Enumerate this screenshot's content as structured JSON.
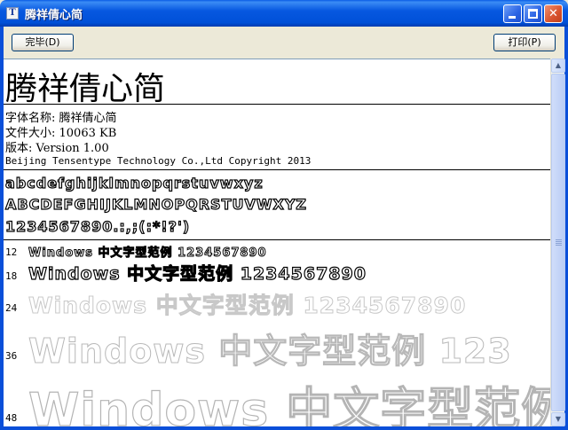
{
  "window": {
    "title": "腾祥倩心简",
    "icon": "font-file-icon"
  },
  "toolbar": {
    "done_label": "完毕(D)",
    "print_label": "打印(P)"
  },
  "font_info": {
    "display_name": "腾祥倩心简",
    "name_line": "字体名称: 腾祥倩心简",
    "size_line": "文件大小: 10063 KB",
    "version_line": "版本: Version 1.00",
    "copyright_line": "Beijing Tensentype Technology Co.,Ltd  Copyright 2013"
  },
  "charset": {
    "lowercase": "abcdefghijklmnopqrstuvwxyz",
    "uppercase": "ABCDEFGHIJKLMNOPQRSTUVWXYZ",
    "digits_symbols": "1234567890.:,;(:*!?')"
  },
  "samples": [
    {
      "size_label": "12",
      "text": "Windows 中文字型范例 1234567890"
    },
    {
      "size_label": "18",
      "text": "Windows 中文字型范例 1234567890"
    },
    {
      "size_label": "24",
      "text": "Windows 中文字型范例 1234567890"
    },
    {
      "size_label": "36",
      "text": "Windows 中文字型范例 123"
    },
    {
      "size_label": "48",
      "text": "Windows 中文字型范例"
    }
  ]
}
